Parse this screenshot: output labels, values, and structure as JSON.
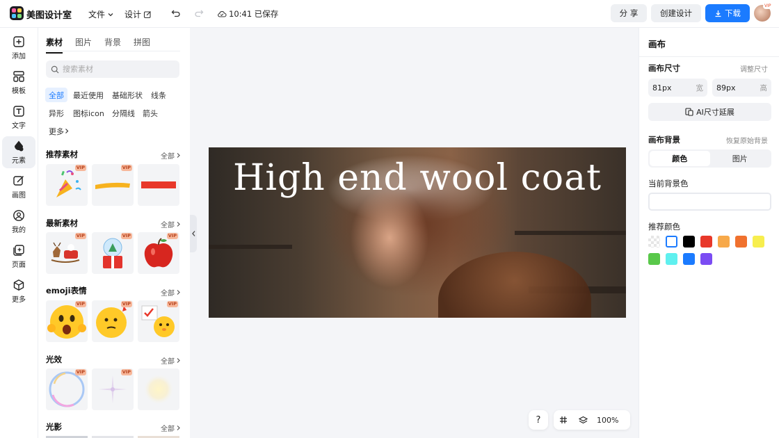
{
  "app": {
    "name": "美图设计室"
  },
  "topbar": {
    "file_menu": "文件",
    "design_menu": "设计",
    "saved_status": "10:41 已保存",
    "share_label": "分 享",
    "create_label": "创建设计",
    "download_label": "下载",
    "avatar_badge": "VIP"
  },
  "rail": {
    "items": [
      {
        "label": "添加",
        "icon": "plus-square-icon"
      },
      {
        "label": "模板",
        "icon": "template-icon"
      },
      {
        "label": "文字",
        "icon": "text-icon"
      },
      {
        "label": "元素",
        "icon": "shapes-icon",
        "active": true
      },
      {
        "label": "画图",
        "icon": "draw-icon"
      },
      {
        "label": "我的",
        "icon": "user-icon"
      },
      {
        "label": "页面",
        "icon": "page-add-icon"
      },
      {
        "label": "更多",
        "icon": "cube-icon"
      }
    ]
  },
  "panel": {
    "tabs": [
      "素材",
      "图片",
      "背景",
      "拼图"
    ],
    "search_placeholder": "搜索素材",
    "chips": [
      "全部",
      "最近使用",
      "基础形状",
      "线条",
      "异形",
      "图标icon",
      "分隔线",
      "箭头",
      "更多"
    ],
    "all_label": "全部",
    "vip_label": "VIP",
    "sections": [
      {
        "title": "推荐素材"
      },
      {
        "title": "最新素材"
      },
      {
        "title": "emoji表情"
      },
      {
        "title": "光效"
      },
      {
        "title": "光影"
      }
    ]
  },
  "canvas": {
    "headline": "High end wool coat"
  },
  "zoom": {
    "help": "?",
    "level": "100%"
  },
  "right_panel": {
    "title": "画布",
    "canvas_size_label": "画布尺寸",
    "resize_link": "调整尺寸",
    "width_value": "81px",
    "width_unit": "宽",
    "height_value": "89px",
    "height_unit": "高",
    "ai_extend_label": "AI尺寸延展",
    "bg_label": "画布背景",
    "restore_bg_link": "恢复原始背景",
    "bg_tabs": [
      "颜色",
      "图片"
    ],
    "current_bg_label": "当前背景色",
    "recommended_label": "推荐颜色",
    "colors": [
      "transparent",
      "#ffffff",
      "#000000",
      "#e8382a",
      "#f7a94a",
      "#f0712e",
      "#f7ee4e",
      "#59c84a",
      "#5ff0ef",
      "#1b7bff",
      "#7b4cf3"
    ]
  }
}
